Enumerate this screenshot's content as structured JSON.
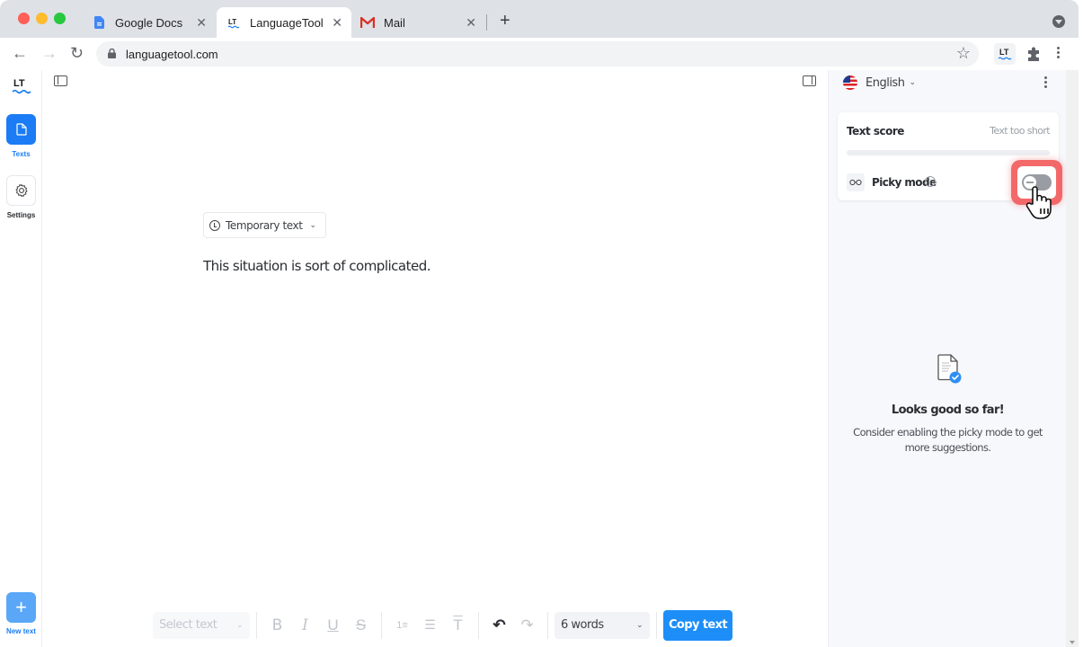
{
  "browser": {
    "tabs": [
      {
        "label": "Google Docs",
        "icon": "google-docs-icon",
        "active": false
      },
      {
        "label": "LanguageTool",
        "icon": "languagetool-icon",
        "active": true
      },
      {
        "label": "Mail",
        "icon": "gmail-icon",
        "active": false
      }
    ],
    "close_glyph": "✕",
    "new_tab_glyph": "+",
    "url": "languagetool.com",
    "back_glyph": "←",
    "forward_glyph": "→",
    "reload_glyph": "↻",
    "star_glyph": "☆"
  },
  "leftnav": {
    "logo": "LT",
    "items": [
      {
        "label": "Texts",
        "icon": "document-icon",
        "active": true
      },
      {
        "label": "Settings",
        "icon": "gear-icon",
        "active": false
      }
    ],
    "new_text": {
      "label": "New text",
      "glyph": "+"
    }
  },
  "editor": {
    "temp_text_label": "Temporary text",
    "chevron": "⌄",
    "content": "This situation is sort of complicated."
  },
  "format_toolbar": {
    "select_placeholder": "Select text",
    "bold": "B",
    "italic": "I",
    "underline": "U",
    "strikethrough": "S",
    "ordered_list": "1≡",
    "bullet_list": "☰",
    "clear_format": "T",
    "undo": "↶",
    "redo": "↷",
    "word_count": "6 words",
    "copy_label": "Copy text"
  },
  "rpanel": {
    "language": "English",
    "score_title": "Text score",
    "score_status": "Text too short",
    "score_progress": 0,
    "picky_mode_label": "Picky mode",
    "picky_mode_enabled": false,
    "picky_icon": "∞",
    "info_glyph": "i",
    "empty_title": "Looks good so far!",
    "empty_desc": "Consider enabling the picky mode to get more suggestions."
  },
  "colors": {
    "accent": "#1d8ef8",
    "highlight": "#f2595a",
    "panel_bg": "#f7f8fc"
  }
}
